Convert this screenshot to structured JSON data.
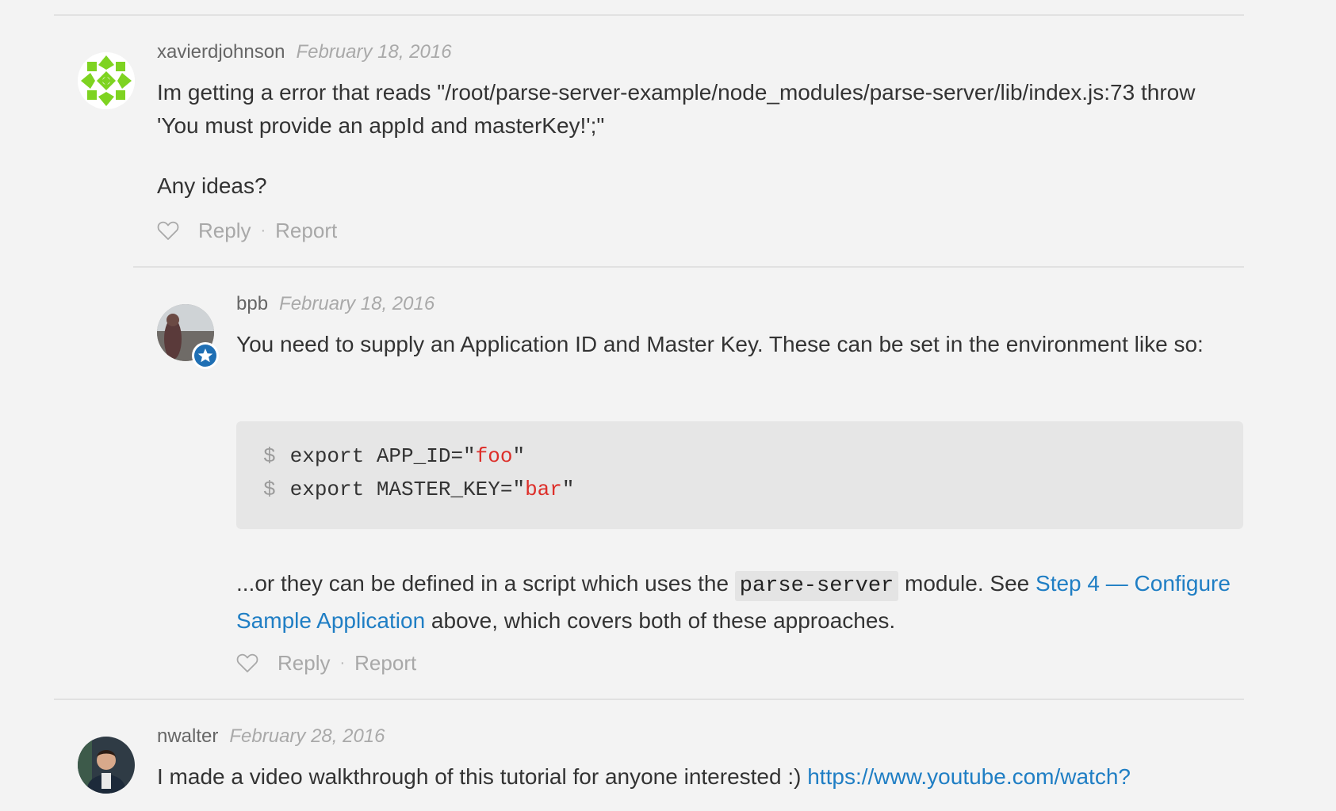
{
  "comments": [
    {
      "author": "xavierdjohnson",
      "date": "February 18, 2016",
      "paragraphs": [
        "Im getting a error that reads \"/root/parse-server-example/node_modules/parse-server/lib/index.js:73 throw 'You must provide an appId and masterKey!';\"",
        "Any ideas?"
      ],
      "reply_label": "Reply",
      "report_label": "Report",
      "separator": "·"
    },
    {
      "author": "bpb",
      "date": "February 18, 2016",
      "paragraph_1": "You need to supply an Application ID and Master Key. These can be set in the environment like so:",
      "code_lines": [
        {
          "prompt": "$",
          "prefix": "export APP_ID=\"",
          "value": "foo",
          "suffix": "\""
        },
        {
          "prompt": "$",
          "prefix": "export MASTER_KEY=\"",
          "value": "bar",
          "suffix": "\""
        }
      ],
      "paragraph_2": {
        "text_before": "...or they can be defined in a script which uses the ",
        "inline_code": "parse-server",
        "text_middle": " module. See ",
        "link_text": "Step 4 — Configure Sample Application",
        "text_after": " above, which covers both of these approaches."
      },
      "reply_label": "Reply",
      "report_label": "Report",
      "separator": "·"
    },
    {
      "author": "nwalter",
      "date": "February 28, 2016",
      "text_before": "I made a video walkthrough of this tutorial for anyone interested :) ",
      "link_text": "https://www.youtube.com/watch?"
    }
  ],
  "colors": {
    "background": "#f3f3f3",
    "link": "#1f7ec4",
    "code_string": "#dd2f2a",
    "badge": "#1f6fb4",
    "identicon": "#7ed321"
  }
}
